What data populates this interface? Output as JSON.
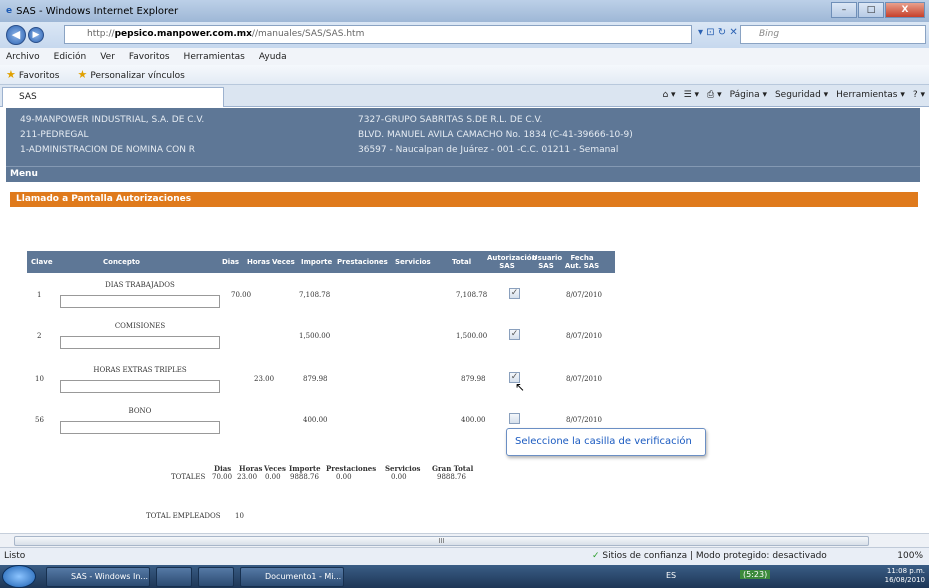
{
  "window": {
    "title": "SAS - Windows Internet Explorer",
    "minimize": "–",
    "restore": "□",
    "close": "X"
  },
  "address": {
    "url_prefix": "http://",
    "url_host": "pepsico.manpower.com.mx",
    "url_path": "//manuales/SAS/SAS.htm",
    "search_placeholder": "Bing"
  },
  "menu": [
    "Archivo",
    "Edición",
    "Ver",
    "Favoritos",
    "Herramientas",
    "Ayuda"
  ],
  "favorites": {
    "label": "Favoritos",
    "link": "Personalizar vínculos"
  },
  "tab": {
    "label": "SAS"
  },
  "tools": {
    "pagina": "Página ▾",
    "seguridad": "Seguridad ▾",
    "herramientas": "Herramientas ▾"
  },
  "header": {
    "left": [
      "49-MANPOWER INDUSTRIAL, S.A. DE C.V.",
      "211-PEDREGAL",
      "1-ADMINISTRACION DE NOMINA CON R"
    ],
    "right": [
      "7327-GRUPO SABRITAS S.DE R.L. DE C.V.",
      "BLVD. MANUEL AVILA CAMACHO No. 1834 (C-41-39666-10-9)",
      "36597 - Naucalpan de Juárez - 001 -C.C. 01211 - Semanal"
    ]
  },
  "menu_label": "Menu",
  "section_title": "Llamado a Pantalla Autorizaciones",
  "table": {
    "headers": {
      "clave": "Clave",
      "concepto": "Concepto",
      "dias": "Dias",
      "horas": "Horas",
      "veces": "Veces",
      "importe": "Importe",
      "prestaciones": "Prestaciones",
      "servicios": "Servicios",
      "total": "Total",
      "autorizacion": "Autorización SAS",
      "usuario": "Usuario SAS",
      "fecha": "Fecha Aut. SAS"
    },
    "rows": [
      {
        "clave": "1",
        "concepto": "DIAS TRABAJADOS",
        "dias": "70.00",
        "horas": "",
        "importe": "7,108.78",
        "total": "7,108.78",
        "checked": "✓",
        "fecha": "8/07/2010"
      },
      {
        "clave": "2",
        "concepto": "COMISIONES",
        "dias": "",
        "horas": "",
        "importe": "1,500.00",
        "total": "1,500.00",
        "checked": "✓",
        "fecha": "8/07/2010"
      },
      {
        "clave": "10",
        "concepto": "HORAS EXTRAS TRIPLES",
        "dias": "",
        "horas": "23.00",
        "importe": "879.98",
        "total": "879.98",
        "checked": "✓",
        "fecha": "8/07/2010"
      },
      {
        "clave": "56",
        "concepto": "BONO",
        "dias": "",
        "horas": "",
        "importe": "400.00",
        "total": "400.00",
        "checked": "",
        "fecha": "8/07/2010"
      }
    ]
  },
  "tooltip": "Seleccione la casilla de verificación",
  "totals": {
    "label": "TOTALES",
    "dias_h": "Dias",
    "horas_h": "Horas",
    "veces_h": "Veces",
    "importe_h": "Importe",
    "prestaciones_h": "Prestaciones",
    "servicios_h": "Servicios",
    "gran_h": "Gran Total",
    "dias": "70.00",
    "horas": "23.00",
    "veces": "0.00",
    "importe": "9888.76",
    "prestaciones": "0.00",
    "servicios": "0.00",
    "gran": "9888.76"
  },
  "empleados": {
    "label": "TOTAL EMPLEADOS",
    "value": "10"
  },
  "scroll_thumb": "III",
  "status": {
    "left": "Listo",
    "zone": "Sitios de confianza | Modo protegido: desactivado",
    "zoom": "100%"
  },
  "taskbar": {
    "ie": "SAS - Windows In...",
    "word": "Documento1 - Mi...",
    "lang": "ES",
    "time": "11:08 p.m.",
    "date": "16/08/2010",
    "battery": "(5:23)"
  }
}
